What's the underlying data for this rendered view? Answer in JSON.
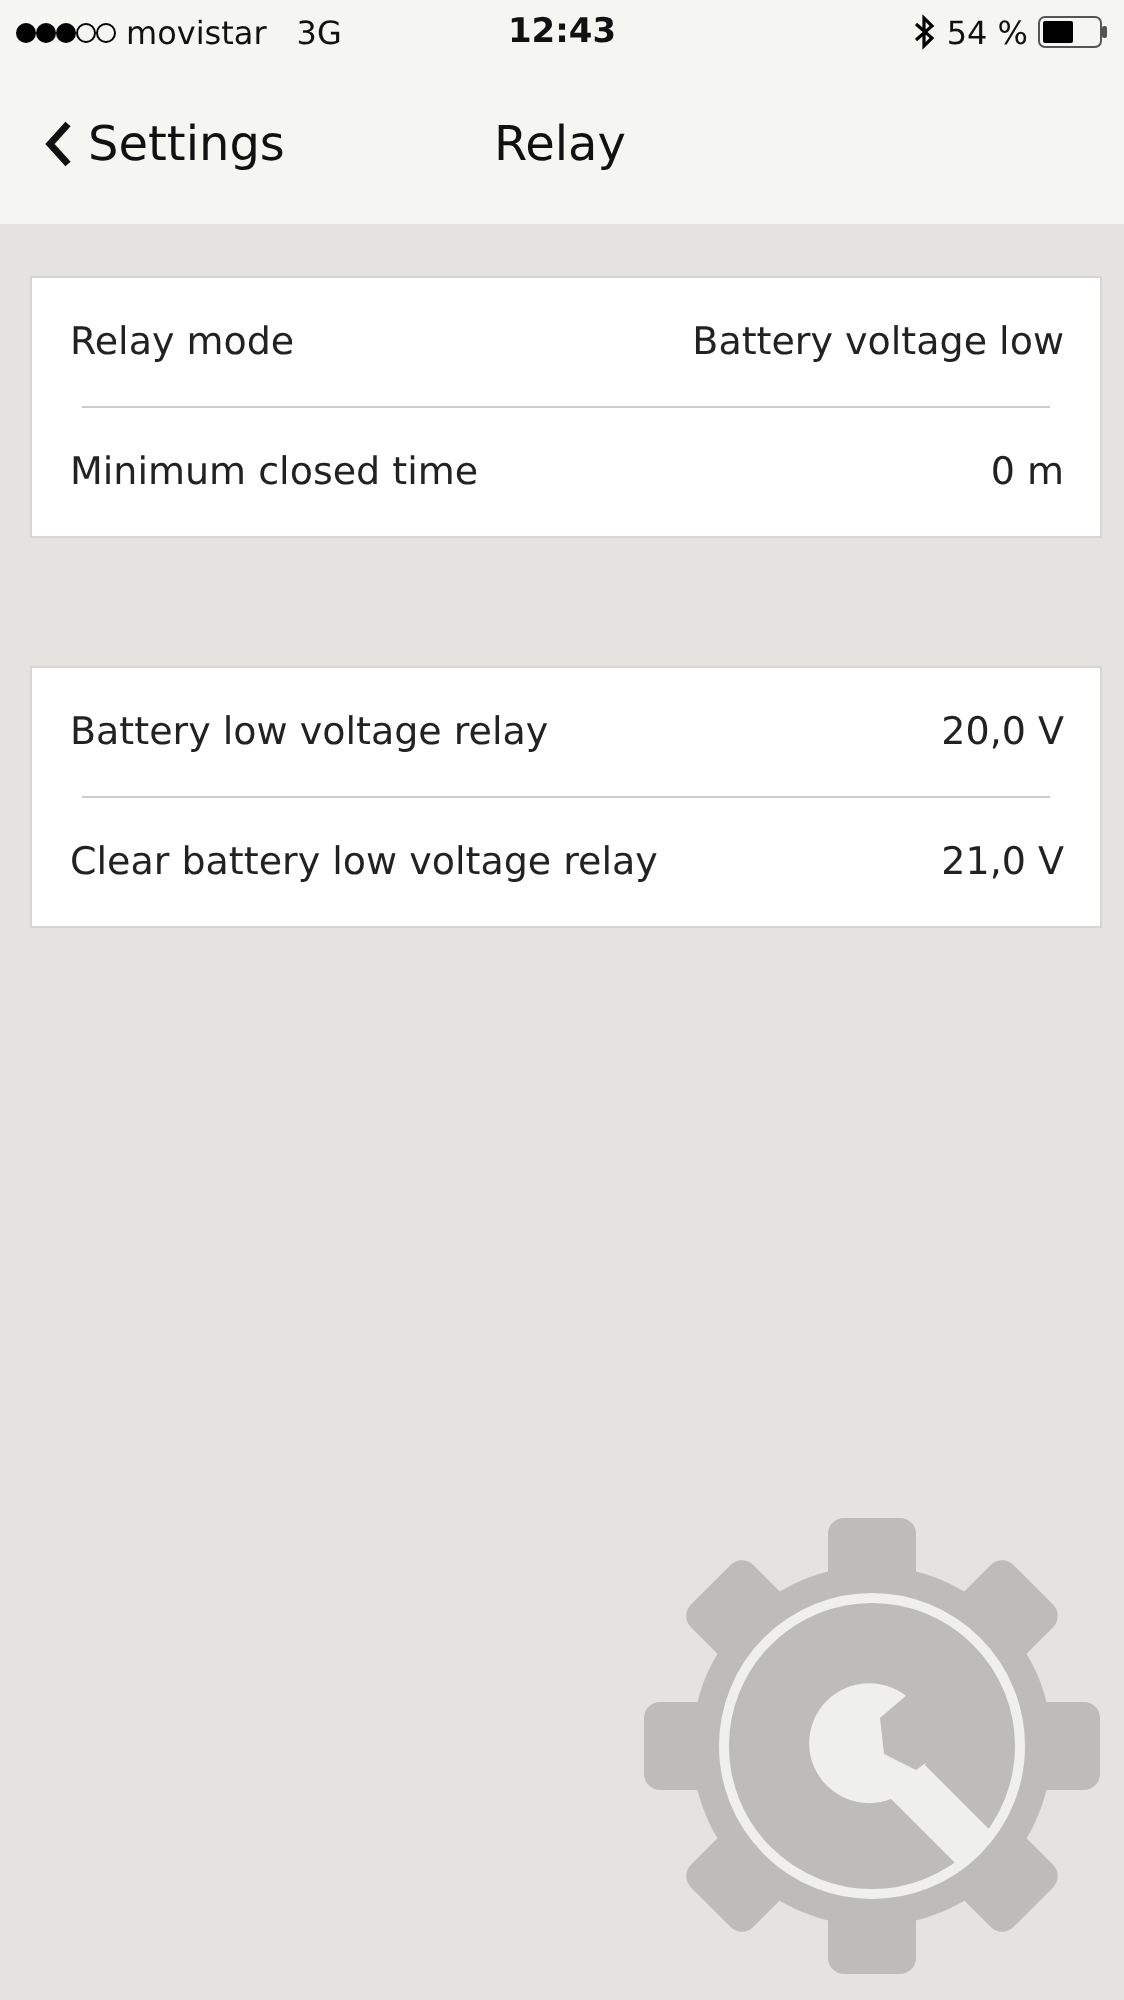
{
  "status_bar": {
    "carrier": "movistar",
    "network": "3G",
    "time": "12:43",
    "battery": "54 %"
  },
  "nav_bar": {
    "back": "Settings",
    "title": "Relay"
  },
  "groups": [
    {
      "rows": [
        {
          "label": "Relay mode",
          "value": "Battery voltage low"
        },
        {
          "label": "Minimum closed time",
          "value": "0 m"
        }
      ]
    },
    {
      "rows": [
        {
          "label": "Battery low voltage relay",
          "value": "20,0 V"
        },
        {
          "label": "Clear battery low voltage relay",
          "value": "21,0 V"
        }
      ]
    }
  ]
}
